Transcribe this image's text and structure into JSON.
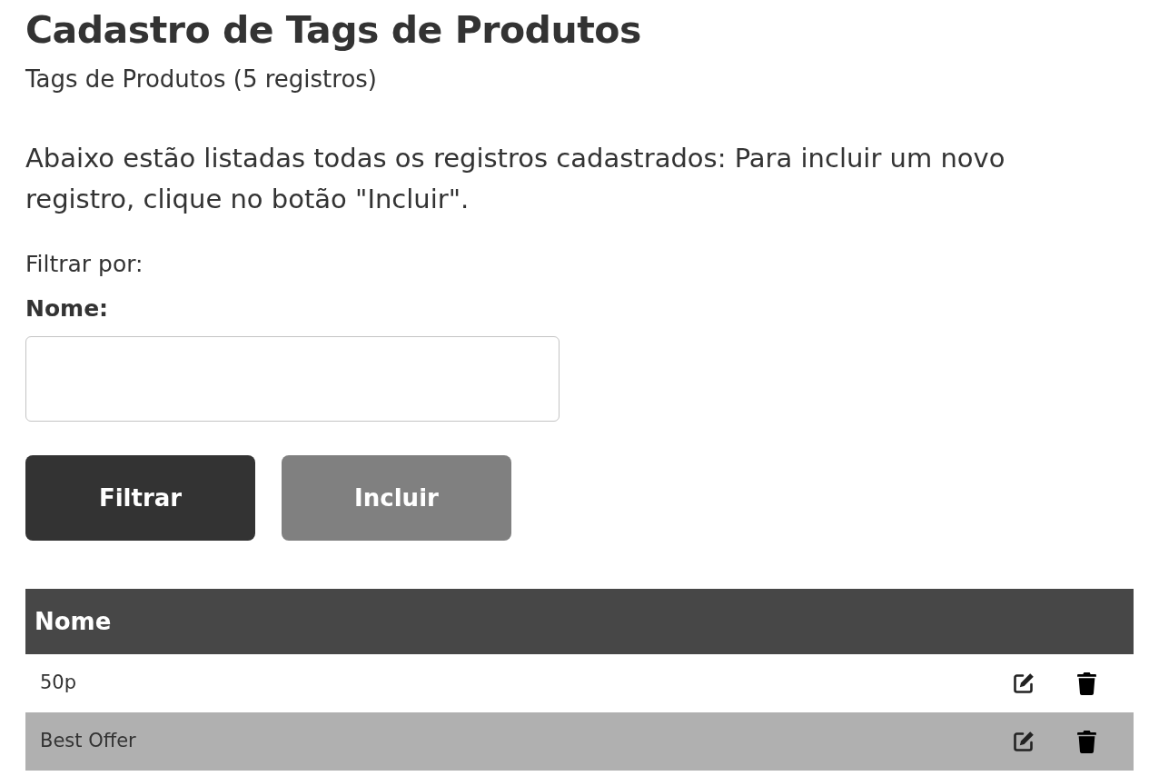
{
  "page": {
    "title": "Cadastro de Tags de Produtos",
    "subtitle": "Tags de Produtos (5 registros)",
    "description": "Abaixo estão listadas todas os registros cadastrados: Para incluir um novo registro, clique no botão \"Incluir\"."
  },
  "filter": {
    "heading": "Filtrar por:",
    "fields": [
      {
        "label": "Nome:"
      }
    ]
  },
  "buttons": [
    {
      "label": "Filtrar",
      "kind": "primary"
    },
    {
      "label": "Incluir",
      "kind": "secondary"
    }
  ],
  "table": {
    "columns": [
      "Nome"
    ],
    "rows": [
      {
        "cells": [
          "50p"
        ]
      },
      {
        "cells": [
          "Best Offer"
        ]
      }
    ]
  }
}
